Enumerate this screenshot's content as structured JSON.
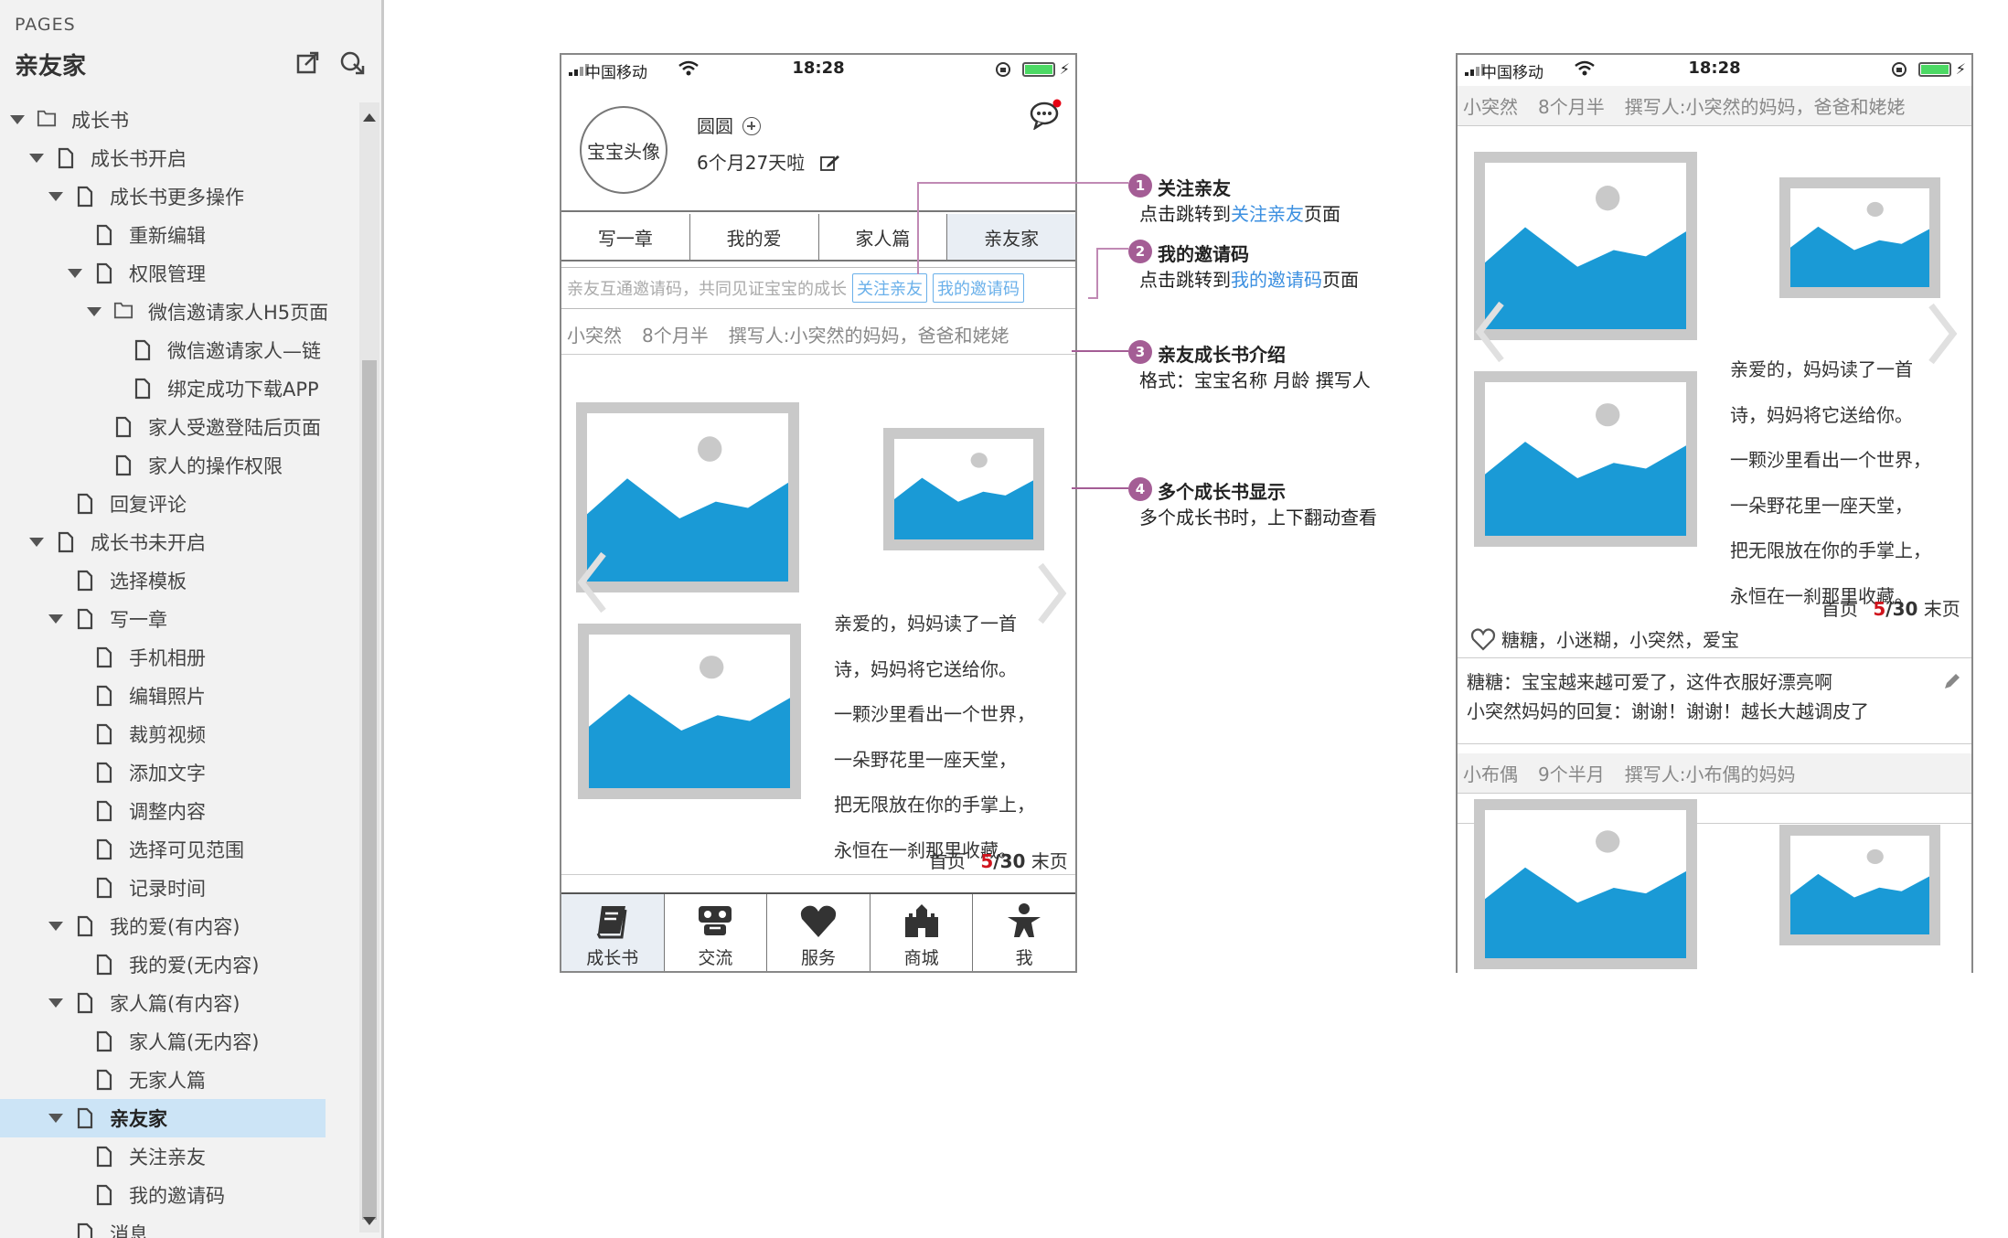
{
  "sidebar": {
    "label": "PAGES",
    "title": "亲友家",
    "tree": [
      {
        "label": "成长书",
        "level": 0,
        "type": "folder",
        "expanded": true
      },
      {
        "label": "成长书开启",
        "level": 1,
        "type": "page",
        "expanded": true
      },
      {
        "label": "成长书更多操作",
        "level": 2,
        "type": "page",
        "expanded": true
      },
      {
        "label": "重新编辑",
        "level": 3,
        "type": "page"
      },
      {
        "label": "权限管理",
        "level": 3,
        "type": "page",
        "expanded": true
      },
      {
        "label": "微信邀请家人H5页面",
        "level": 4,
        "type": "folder",
        "expanded": true
      },
      {
        "label": "微信邀请家人—链",
        "level": 5,
        "type": "page"
      },
      {
        "label": "绑定成功下载APP",
        "level": 5,
        "type": "page"
      },
      {
        "label": "家人受邀登陆后页面",
        "level": 4,
        "type": "page"
      },
      {
        "label": "家人的操作权限",
        "level": 4,
        "type": "page"
      },
      {
        "label": "回复评论",
        "level": 2,
        "type": "page"
      },
      {
        "label": "成长书未开启",
        "level": 1,
        "type": "page",
        "expanded": true
      },
      {
        "label": "选择模板",
        "level": 2,
        "type": "page"
      },
      {
        "label": "写一章",
        "level": 2,
        "type": "page",
        "expanded": true
      },
      {
        "label": "手机相册",
        "level": 3,
        "type": "page"
      },
      {
        "label": "编辑照片",
        "level": 3,
        "type": "page"
      },
      {
        "label": "裁剪视频",
        "level": 3,
        "type": "page"
      },
      {
        "label": "添加文字",
        "level": 3,
        "type": "page"
      },
      {
        "label": "调整内容",
        "level": 3,
        "type": "page"
      },
      {
        "label": "选择可见范围",
        "level": 3,
        "type": "page"
      },
      {
        "label": "记录时间",
        "level": 3,
        "type": "page"
      },
      {
        "label": "我的爱(有内容)",
        "level": 2,
        "type": "page",
        "expanded": true
      },
      {
        "label": "我的爱(无内容)",
        "level": 3,
        "type": "page"
      },
      {
        "label": "家人篇(有内容)",
        "level": 2,
        "type": "page",
        "expanded": true
      },
      {
        "label": "家人篇(无内容)",
        "level": 3,
        "type": "page"
      },
      {
        "label": "无家人篇",
        "level": 3,
        "type": "page"
      },
      {
        "label": "亲友家",
        "level": 2,
        "type": "page",
        "expanded": true,
        "selected": true
      },
      {
        "label": "关注亲友",
        "level": 3,
        "type": "page"
      },
      {
        "label": "我的邀请码",
        "level": 3,
        "type": "page"
      },
      {
        "label": "消息",
        "level": 2,
        "type": "page"
      }
    ]
  },
  "status": {
    "carrier": "中国移动",
    "time": "18:28"
  },
  "phone1": {
    "avatar_text": "宝宝头像",
    "name": "圆圆",
    "age": "6个月27天啦",
    "tabs": [
      "写一章",
      "我的爱",
      "家人篇",
      "亲友家"
    ],
    "invite_text": "亲友互通邀请码，共同见证宝宝的成长",
    "follow_btn": "关注亲友",
    "code_btn": "我的邀请码",
    "book": {
      "baby": "小突然",
      "age": "8个月半",
      "writer": "撰写人:小突然的妈妈，爸爸和姥姥"
    },
    "poem": [
      "亲爱的，妈妈读了一首",
      "诗，妈妈将它送给你。",
      "一颗沙里看出一个世界，",
      "一朵野花里一座天堂，",
      "把无限放在你的手掌上，",
      "永恒在一刹那里收藏。"
    ],
    "pager": {
      "first": "首页",
      "current": "5",
      "total": "/30",
      "last": "末页"
    },
    "nav": [
      "成长书",
      "交流",
      "服务",
      "商城",
      "我"
    ]
  },
  "phone2": {
    "book1": {
      "baby": "小突然",
      "age": "8个月半",
      "writer": "撰写人:小突然的妈妈，爸爸和姥姥"
    },
    "poem": [
      "亲爱的，妈妈读了一首",
      "诗，妈妈将它送给你。",
      "一颗沙里看出一个世界，",
      "一朵野花里一座天堂，",
      "把无限放在你的手掌上，",
      "永恒在一刹那里收藏。"
    ],
    "pager": {
      "first": "首页",
      "current": "5",
      "total": "/30",
      "last": "末页"
    },
    "likes": "糖糖，小迷糊，小突然，爱宝",
    "comment1": "糖糖：宝宝越来越可爱了，这件衣服好漂亮啊",
    "comment2": "小突然妈妈的回复：谢谢！谢谢！越长大越调皮了",
    "book2": {
      "baby": "小布偶",
      "age": "9个半月",
      "writer": "撰写人:小布偶的妈妈"
    }
  },
  "annotations": [
    {
      "num": "1",
      "title": "关注亲友",
      "desc_pre": "点击跳转到",
      "desc_link": "关注亲友",
      "desc_post": "页面"
    },
    {
      "num": "2",
      "title": "我的邀请码",
      "desc_pre": "点击跳转到",
      "desc_link": "我的邀请码",
      "desc_post": "页面"
    },
    {
      "num": "3",
      "title": "亲友成长书介绍",
      "desc_pre": "格式：宝宝名称 月龄 撰写人",
      "desc_link": "",
      "desc_post": ""
    },
    {
      "num": "4",
      "title": "多个成长书显示",
      "desc_pre": "多个成长书时，上下翻动查看",
      "desc_link": "",
      "desc_post": ""
    }
  ],
  "colors": {
    "accent_link": "#3b8fe0",
    "badge": "#a45d95",
    "image_fill": "#1a9ad6",
    "selected_row": "#cce4f6",
    "page_current": "#d0141d"
  }
}
